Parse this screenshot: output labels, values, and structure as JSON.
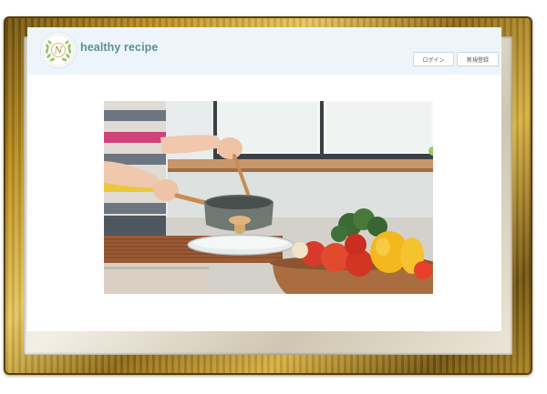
{
  "site": {
    "brand_name": "healthy recipe",
    "logo_letter": "N"
  },
  "header": {
    "login_label": "ログイン",
    "register_label": "新規登録"
  },
  "hero": {
    "image": "cooking-kitchen-photo"
  },
  "colors": {
    "header_bg": "#eef5fa",
    "brand_text": "#5e8f93",
    "frame_gold": "#b88c1d"
  }
}
